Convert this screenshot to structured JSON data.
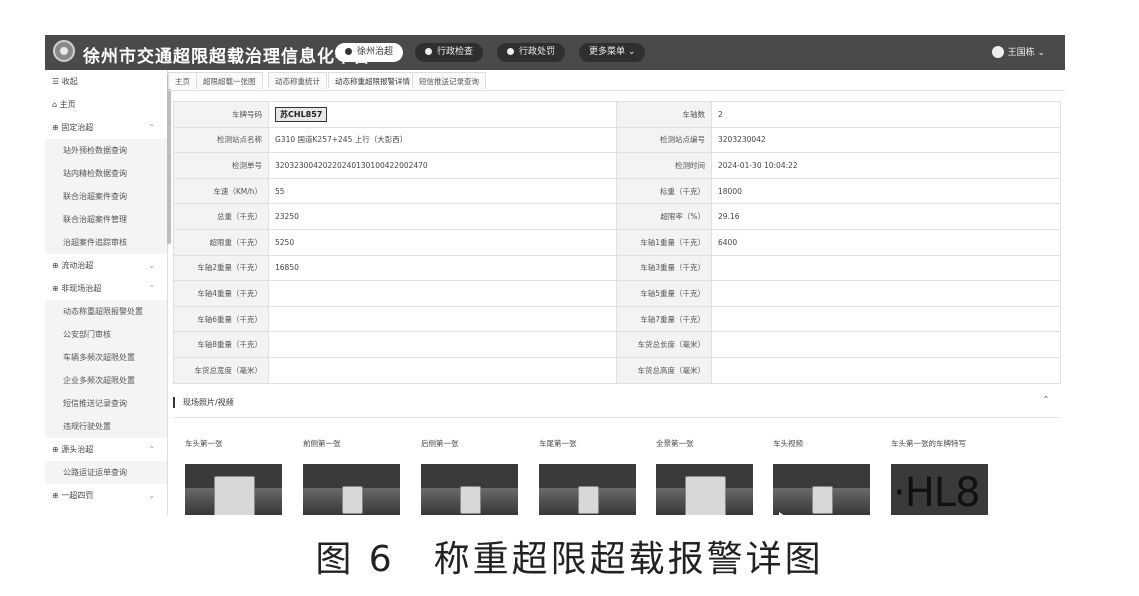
{
  "header": {
    "app_title": "徐州市交通超限超载治理信息化平台",
    "nav": [
      "徐州治超",
      "行政检查",
      "行政处罚",
      "更多菜单 ⌄"
    ],
    "user_name": "王国栋 ⌄"
  },
  "sidebar": {
    "items": [
      {
        "label": "收起",
        "sub": false
      },
      {
        "label": "主页",
        "sub": false
      },
      {
        "label": "固定治超",
        "sub": false,
        "caret": "⌃"
      },
      {
        "label": "站外预检数据查询",
        "sub": true
      },
      {
        "label": "站内精检数据查询",
        "sub": true
      },
      {
        "label": "联合治超案件查询",
        "sub": true
      },
      {
        "label": "联合治超案件管理",
        "sub": true
      },
      {
        "label": "治超案件追踪审核",
        "sub": true
      },
      {
        "label": "流动治超",
        "sub": false,
        "caret": "⌄"
      },
      {
        "label": "非现场治超",
        "sub": false,
        "caret": "⌃"
      },
      {
        "label": "动态称重超限报警处置",
        "sub": true
      },
      {
        "label": "公安部门审核",
        "sub": true
      },
      {
        "label": "车辆多频次超限处置",
        "sub": true
      },
      {
        "label": "企业多频次超限处置",
        "sub": true
      },
      {
        "label": "短信推送记录查询",
        "sub": true
      },
      {
        "label": "违规行驶处置",
        "sub": true
      },
      {
        "label": "源头治超",
        "sub": false,
        "caret": "⌃"
      },
      {
        "label": "公路运证运单查询",
        "sub": true
      },
      {
        "label": "一超四罚",
        "sub": false,
        "caret": "⌄"
      }
    ]
  },
  "tabs": [
    "主页",
    "超限超载一张图",
    "动态称重统计",
    "动态称重超限报警详情 ×",
    "短信推送记录查询"
  ],
  "detail": {
    "rows": [
      [
        "车牌号码",
        "苏CHL857",
        "车轴数",
        "2"
      ],
      [
        "检测站点名称",
        "G310 国道K257+245 上行（大彭西）",
        "检测站点编号",
        "3203230042"
      ],
      [
        "检测单号",
        "32032300420220240130100422002470",
        "检测时间",
        "2024-01-30 10:04:22"
      ],
      [
        "车速（KM/h）",
        "55",
        "标重（千克）",
        "18000"
      ],
      [
        "总重（千克）",
        "23250",
        "超限率（%）",
        "29.16"
      ],
      [
        "超限重（千克）",
        "5250",
        "车轴1重量（千克）",
        "6400"
      ],
      [
        "车轴2重量（千克）",
        "16850",
        "车轴3重量（千克）",
        ""
      ],
      [
        "车轴4重量（千克）",
        "",
        "车轴5重量（千克）",
        ""
      ],
      [
        "车轴6重量（千克）",
        "",
        "车轴7重量（千克）",
        ""
      ],
      [
        "车轴8重量（千克）",
        "",
        "车货总长度（毫米）",
        ""
      ],
      [
        "车货总宽度（毫米）",
        "",
        "车货总高度（毫米）",
        ""
      ]
    ]
  },
  "media_section": {
    "title": "现场照片/视频",
    "toggle": "⌃",
    "items": [
      "车头第一张",
      "前侧第一张",
      "后侧第一张",
      "车尾第一张",
      "全景第一张",
      "车头视频",
      "车头第一张的车牌特写"
    ],
    "plate_closeup_text": "·HL8"
  },
  "figure_caption": "图 6　称重超限超载报警详图"
}
